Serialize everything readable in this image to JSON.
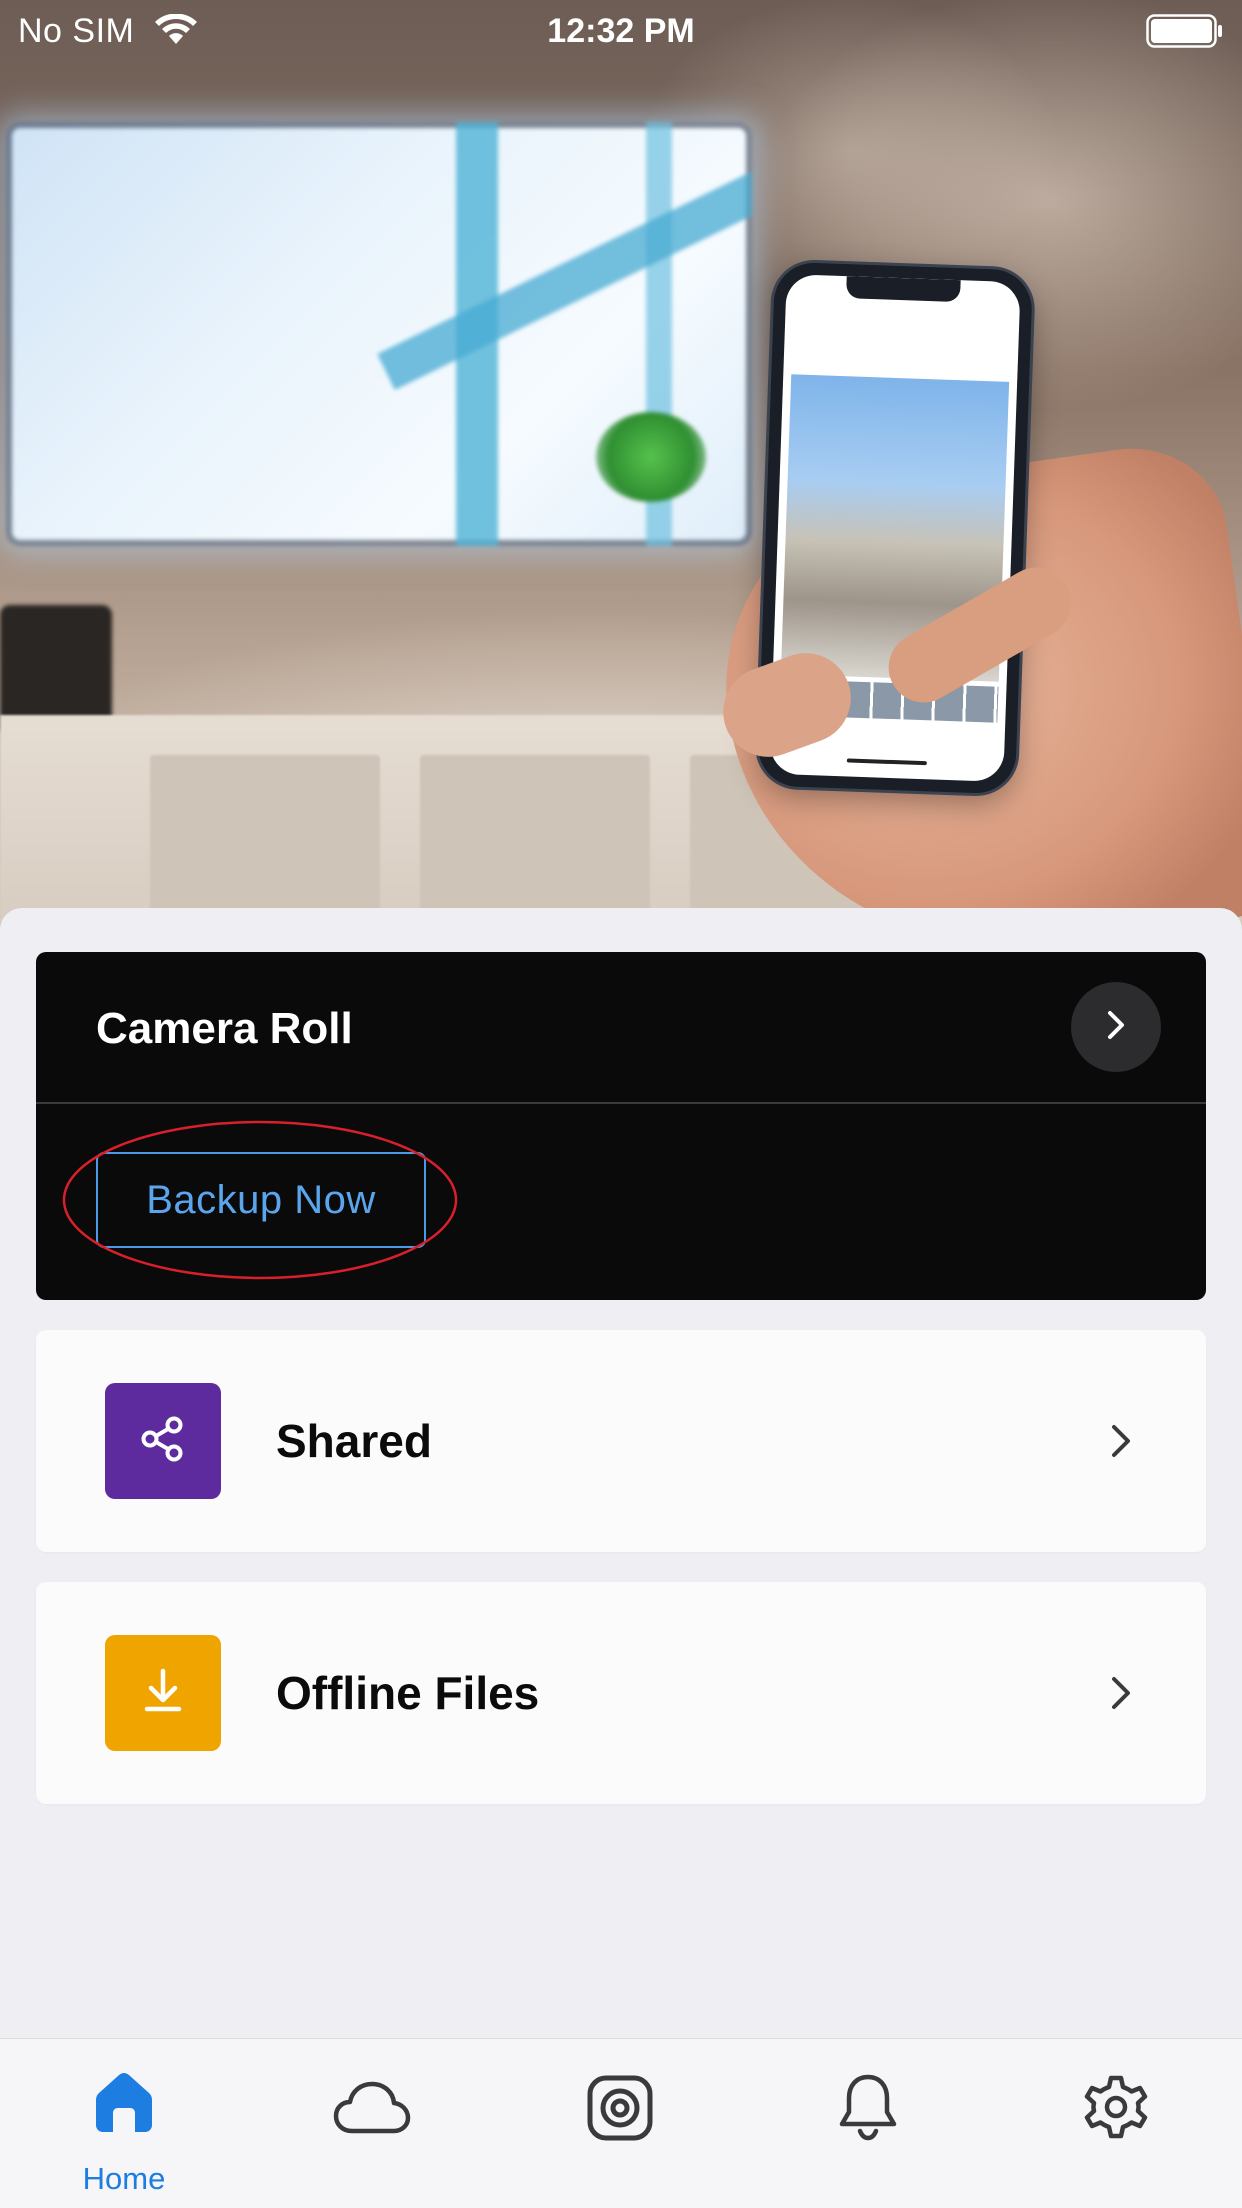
{
  "status_bar": {
    "carrier": "No SIM",
    "time": "12:32 PM"
  },
  "camera_roll": {
    "title": "Camera Roll",
    "backup_button": "Backup Now"
  },
  "rows": [
    {
      "label": "Shared",
      "tile_color": "#5e2b9f",
      "icon": "share-icon"
    },
    {
      "label": "Offline Files",
      "tile_color": "#f0a400",
      "icon": "download-icon"
    }
  ],
  "tab_bar": {
    "tabs": [
      {
        "label": "Home",
        "icon": "home-icon",
        "active": true
      },
      {
        "label": "",
        "icon": "cloud-icon",
        "active": false
      },
      {
        "label": "",
        "icon": "camera-target-icon",
        "active": false
      },
      {
        "label": "",
        "icon": "bell-icon",
        "active": false
      },
      {
        "label": "",
        "icon": "gear-icon",
        "active": false
      }
    ],
    "active_color": "#1d7de0",
    "inactive_color": "#3a3a3c"
  },
  "colors": {
    "highlight_ring": "#d8202a",
    "backup_button": "#4a9ae6",
    "card_dark": "#0a0a0b"
  }
}
